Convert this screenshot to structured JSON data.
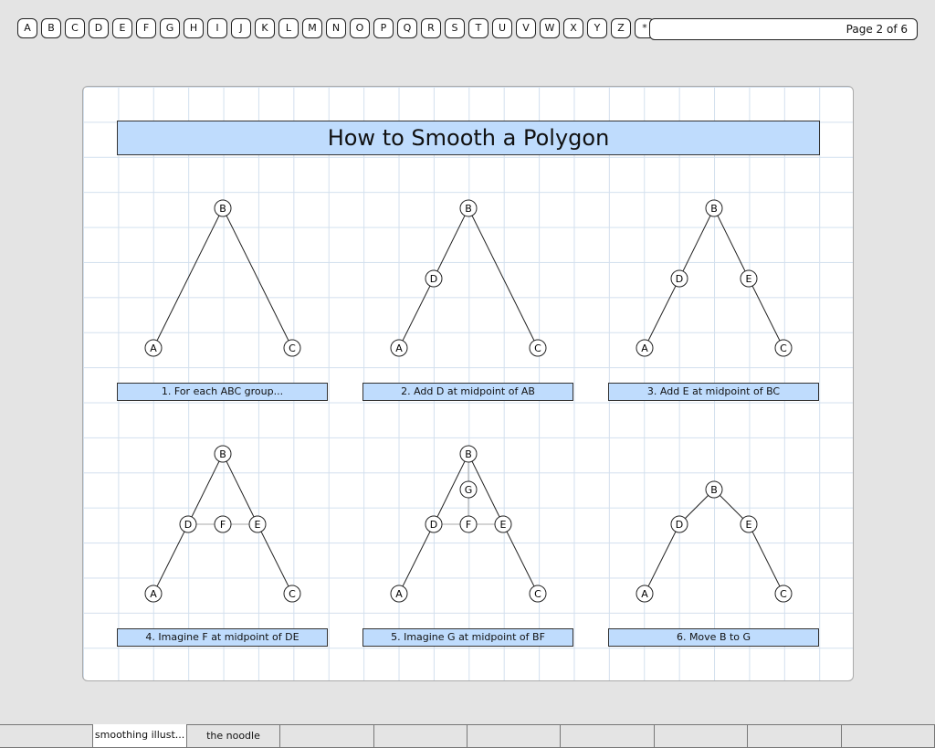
{
  "letters": [
    "A",
    "B",
    "C",
    "D",
    "E",
    "F",
    "G",
    "H",
    "I",
    "J",
    "K",
    "L",
    "M",
    "N",
    "O",
    "P",
    "Q",
    "R",
    "S",
    "T",
    "U",
    "V",
    "W",
    "X",
    "Y",
    "Z",
    "*"
  ],
  "page_indicator": "Page 2 of 6",
  "title": "How to Smooth a Polygon",
  "captions": [
    "1. For each ABC group...",
    "2. Add D at midpoint of AB",
    "3. Add E at midpoint of BC",
    "4. Imagine F at midpoint of DE",
    "5. Imagine G at midpoint of BF",
    "6. Move B to G"
  ],
  "node_labels": {
    "A": "A",
    "B": "B",
    "C": "C",
    "D": "D",
    "E": "E",
    "F": "F",
    "G": "G"
  },
  "tabs": [
    "",
    "smoothing illust...",
    "the noodle",
    "",
    "",
    "",
    "",
    "",
    "",
    ""
  ],
  "active_tab": 1,
  "colors": {
    "caption_fill": "#bfdcfd",
    "grid": "#d3e0ee"
  }
}
